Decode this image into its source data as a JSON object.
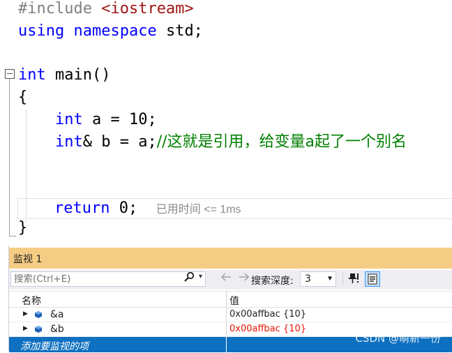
{
  "code": {
    "line1_pp": "#include",
    "line1_header": "<iostream>",
    "line2_kw1": "using",
    "line2_kw2": "namespace",
    "line2_rest": " std;",
    "line3_kw": "int",
    "line3_rest": " main()",
    "line4": "{",
    "line5_kw": "int",
    "line5_rest": " a = 10;",
    "line6_kw": "int",
    "line6_rest": "& b = a;",
    "line6_comment": "//这就是引用，给变量a起了一个别名",
    "line7_kw": "return",
    "line7_rest": " 0;",
    "line7_hint": "已用时间 <= 1ms",
    "line8": "}"
  },
  "watch": {
    "title": "监视 1",
    "search_placeholder": "搜索(Ctrl+E)",
    "depth_label": "搜索深度:",
    "depth_value": "3",
    "col_name": "名称",
    "col_value": "值",
    "rows": [
      {
        "name": "&a",
        "value": "0x00affbac {10}",
        "value_color": "#1e1e1e"
      },
      {
        "name": "&b",
        "value": "0x00affbac {10}",
        "value_color": "#e51400"
      }
    ],
    "add_watch": "添加要监视的项"
  },
  "icons": {
    "fold": "collapse-icon",
    "search": "search-icon",
    "back": "back-arrow-icon",
    "forward": "forward-arrow-icon",
    "pin": "pin-icon",
    "hex": "hex-display-icon",
    "variable": "variable-icon"
  },
  "watermark": "CSDN @萌新一份"
}
